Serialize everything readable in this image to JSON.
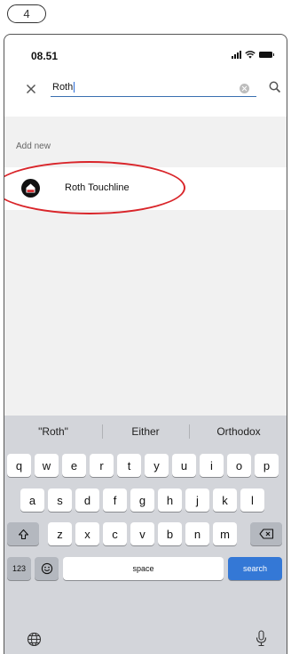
{
  "step": "4",
  "status": {
    "time": "08.51"
  },
  "search": {
    "query": "Roth"
  },
  "section": {
    "header": "Add new"
  },
  "results": [
    {
      "label": "Roth Touchline",
      "icon": "roth-logo-icon"
    }
  ],
  "keyboard": {
    "suggestions": [
      "\"Roth\"",
      "Either",
      "Orthodox"
    ],
    "row1": [
      "q",
      "w",
      "e",
      "r",
      "t",
      "y",
      "u",
      "i",
      "o",
      "p"
    ],
    "row2": [
      "a",
      "s",
      "d",
      "f",
      "g",
      "h",
      "j",
      "k",
      "l"
    ],
    "row3": [
      "z",
      "x",
      "c",
      "v",
      "b",
      "n",
      "m"
    ],
    "numbers_key": "123",
    "space_key": "space",
    "go_key": "search"
  },
  "colors": {
    "accent": "#3478d6",
    "highlight": "#d9252a",
    "underline": "#3a6fb0"
  }
}
